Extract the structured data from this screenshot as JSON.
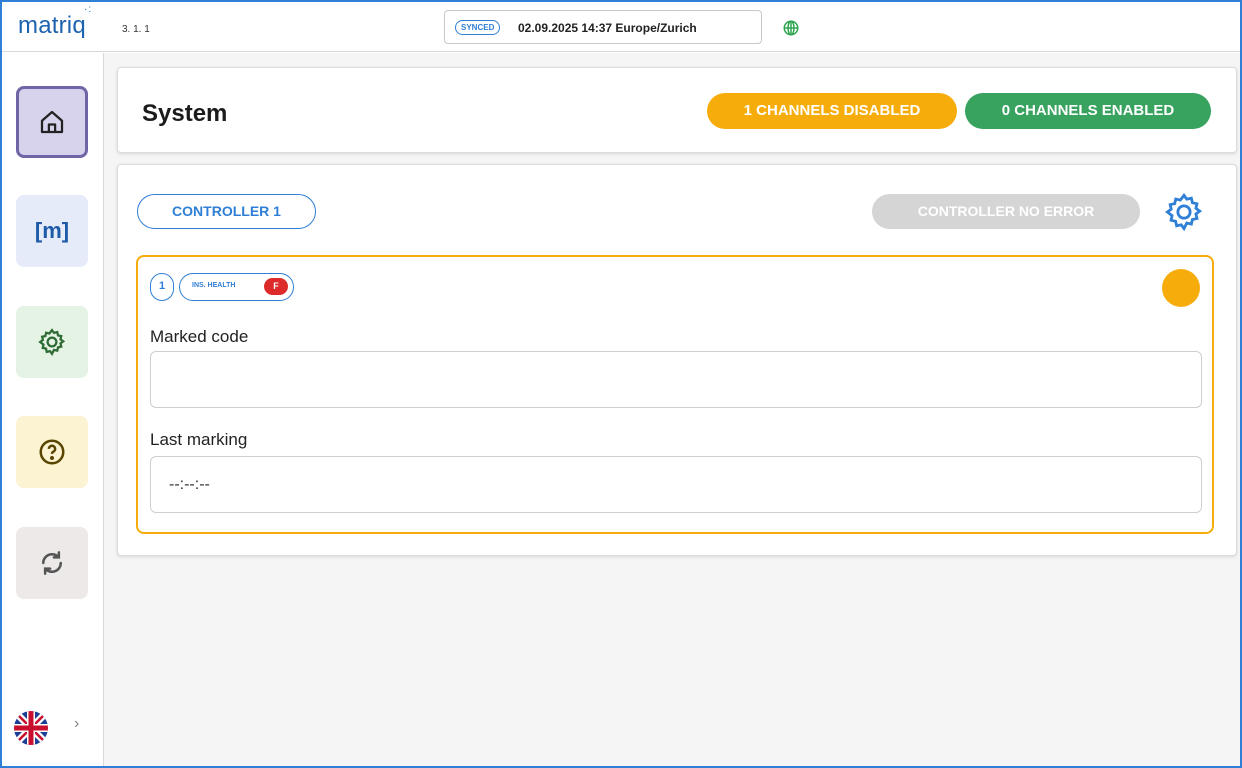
{
  "app": {
    "logo": "matriq",
    "logo_dots": "·:",
    "version": "3. 1. 1"
  },
  "topbar": {
    "sync_badge": "SYNCED",
    "datetime": "02.09.2025 14:37 Europe/Zurich"
  },
  "sidebar": {
    "items": [
      {
        "name": "home",
        "icon": "home-icon",
        "color": "#d7d3ec"
      },
      {
        "name": "matriq",
        "icon": "bracket-m-icon",
        "label": "[m]",
        "color": "#e6ebf9"
      },
      {
        "name": "settings",
        "icon": "gear-icon",
        "color": "#e4f3e4"
      },
      {
        "name": "help",
        "icon": "question-circle-icon",
        "color": "#fbf3d2"
      },
      {
        "name": "sync",
        "icon": "refresh-icon",
        "color": "#ede9e9"
      }
    ],
    "language_icon": "uk-flag-icon",
    "language_chevron": "›"
  },
  "header": {
    "title": "System",
    "channels_disabled": "1 CHANNELS DISABLED",
    "channels_enabled": "0 CHANNELS ENABLED"
  },
  "controller": {
    "name": "CONTROLLER 1",
    "status": "CONTROLLER NO ERROR",
    "channel": {
      "number": "1",
      "health_label": "INS. HEALTH",
      "health_badge": "F",
      "status_color": "#f6ad0c",
      "marked_code_label": "Marked code",
      "marked_code_value": "",
      "last_marking_label": "Last marking",
      "last_marking_value": "--:--:--"
    }
  },
  "colors": {
    "accent": "#2f7fd6",
    "warning": "#f6ad0c",
    "success": "#38a25f",
    "error": "#dd2b2b"
  }
}
